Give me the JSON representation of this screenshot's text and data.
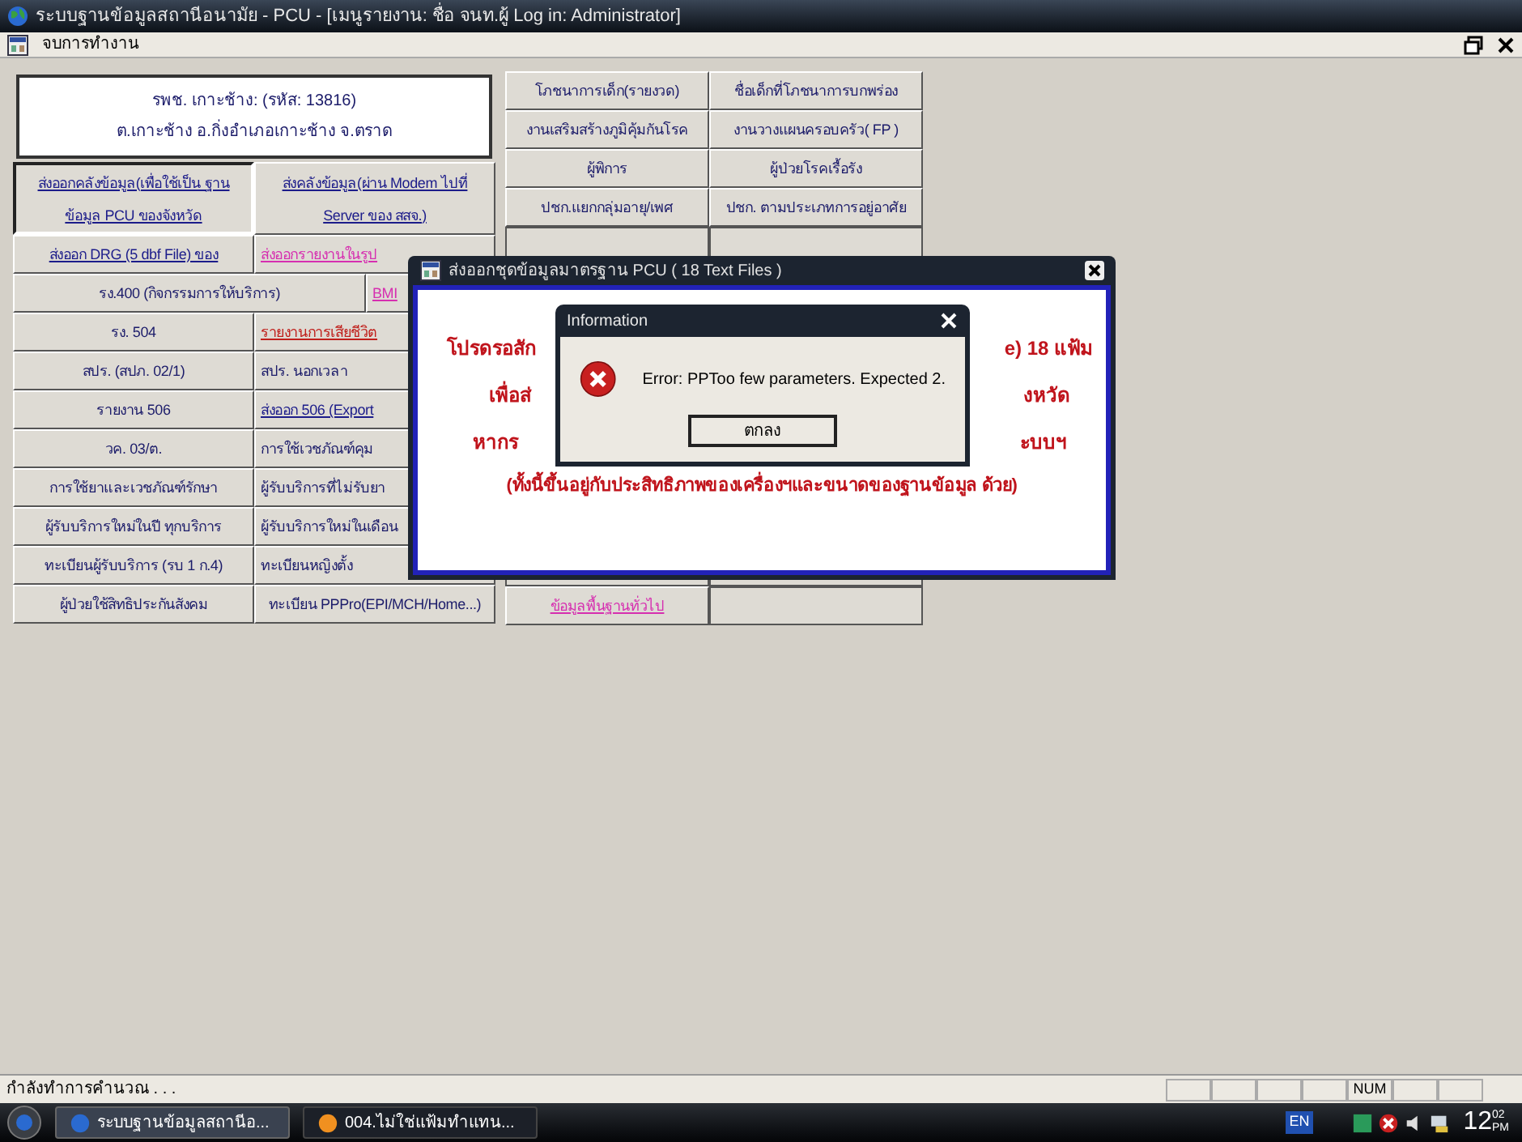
{
  "window": {
    "title": "ระบบฐานข้อมูลสถานีอนามัย - PCU - [เมนูรายงาน: ชื่อ จนท.ผู้ Log in: Administrator]"
  },
  "menu": {
    "items": [
      "จบการทำงาน"
    ]
  },
  "header": {
    "lines": [
      "รพช. เกาะช้าง: (รหัส: 13816)",
      "ต.เกาะช้าง อ.กิ่งอำเภอเกาะช้าง จ.ตราด"
    ]
  },
  "left_grid": {
    "rows": [
      {
        "cells": [
          {
            "text": "ส่งออกคลังข้อมูล(เพื่อใช้เป็น ฐานข้อมูล PCU ของจังหวัด",
            "kind": "link",
            "pressed": true
          },
          {
            "text": "ส่งคลังข้อมูล(ผ่าน Modem ไปที่ Server ของ สสจ.)",
            "kind": "link",
            "pressed": false
          }
        ]
      },
      {
        "cells": [
          {
            "text": "ส่งออก DRG (5 dbf File) ของ",
            "kind": "link",
            "pressed": false
          },
          {
            "text": "ส่งออกรายงานในรูป",
            "kind": "pink",
            "pressed": false,
            "cut": true
          }
        ]
      },
      {
        "cells": [
          {
            "text": "รง.400 (กิจกรรมการให้บริการ)",
            "kind": "plain",
            "pressed": false,
            "wide": true
          },
          {
            "text": "BMI",
            "kind": "pink",
            "pressed": false,
            "cut": true
          }
        ]
      },
      {
        "cells": [
          {
            "text": "รง. 504",
            "kind": "plain",
            "pressed": false
          },
          {
            "text": "รายงานการเสียชีวิต",
            "kind": "red",
            "pressed": false,
            "cut": true
          }
        ]
      },
      {
        "cells": [
          {
            "text": "สปร. (สปภ. 02/1)",
            "kind": "plain",
            "pressed": false
          },
          {
            "text": "สปร. นอกเวลา",
            "kind": "plain",
            "pressed": false,
            "cut": true
          }
        ]
      },
      {
        "cells": [
          {
            "text": "รายงาน 506",
            "kind": "plain",
            "pressed": false
          },
          {
            "text": "ส่งออก 506 (Export",
            "kind": "link",
            "pressed": false,
            "cut": true
          }
        ]
      },
      {
        "cells": [
          {
            "text": "วค. 03/ต.",
            "kind": "plain",
            "pressed": false
          },
          {
            "text": "การใช้เวชภัณฑ์คุม",
            "kind": "plain",
            "pressed": false,
            "cut": true
          }
        ]
      },
      {
        "cells": [
          {
            "text": "การใช้ยาและเวชภัณฑ์รักษา",
            "kind": "plain",
            "pressed": false
          },
          {
            "text": "ผู้รับบริการที่ไม่รับยา",
            "kind": "plain",
            "pressed": false,
            "cut": true
          }
        ]
      },
      {
        "cells": [
          {
            "text": "ผู้รับบริการใหม่ในปี ทุกบริการ",
            "kind": "plain",
            "pressed": false
          },
          {
            "text": "ผู้รับบริการใหม่ในเดือน",
            "kind": "plain",
            "pressed": false,
            "cut": true
          }
        ]
      },
      {
        "cells": [
          {
            "text": "ทะเบียนผู้รับบริการ (รบ 1 ก.4)",
            "kind": "plain",
            "pressed": false
          },
          {
            "text": "ทะเบียนหญิงตั้ง",
            "kind": "plain",
            "pressed": false,
            "cut": true
          }
        ]
      },
      {
        "cells": [
          {
            "text": "ผู้ป่วยใช้สิทธิประกันสังคม",
            "kind": "plain",
            "pressed": false
          },
          {
            "text": "ทะเบียน PPPro(EPI/MCH/Home...)",
            "kind": "plain",
            "pressed": false
          }
        ]
      }
    ]
  },
  "right_grid": {
    "rows": [
      {
        "cells": [
          {
            "text": "โภชนาการเด็ก(รายงวด)",
            "kind": "plain"
          },
          {
            "text": "ชื่อเด็กที่โภชนาการบกพร่อง",
            "kind": "plain"
          }
        ]
      },
      {
        "cells": [
          {
            "text": "งานเสริมสร้างภูมิคุ้มกันโรค",
            "kind": "plain"
          },
          {
            "text": "งานวางแผนครอบครัว( FP )",
            "kind": "plain"
          }
        ]
      },
      {
        "cells": [
          {
            "text": "ผู้พิการ",
            "kind": "plain"
          },
          {
            "text": "ผู้ป่วยโรคเรื้อรัง",
            "kind": "plain"
          }
        ]
      },
      {
        "cells": [
          {
            "text": "ปชก.แยกกลุ่มอายุ/เพศ",
            "kind": "plain"
          },
          {
            "text": "ปชก. ตามประเภทการอยู่อาศัย",
            "kind": "plain"
          }
        ]
      }
    ],
    "bottom_row": [
      {
        "text": "ข้อมูลพื้นฐานทั่วไป",
        "kind": "pink"
      }
    ]
  },
  "export_dialog": {
    "title": "ส่งออกชุดข้อมูลมาตรฐาน PCU ( 18 Text Files )",
    "lines": [
      {
        "left": "โปรดรอสัก",
        "right": "e) 18 แฟ้ม"
      },
      {
        "left": "เพื่อส่",
        "right": "งหวัด"
      },
      {
        "left": "หากร",
        "right": "ะบบฯ"
      }
    ],
    "note": "(ทั้งนี้ขึ้นอยู่กับประสิทธิภาพของเครื่องฯและขนาดของฐานข้อมูล ด้วย)"
  },
  "message_box": {
    "title": "Information",
    "message": "Error: PPToo few parameters. Expected 2.",
    "button": "ตกลง"
  },
  "status_bar": {
    "text": "กำลังทำการคำนวณ . . .",
    "num_indicator": "NUM"
  },
  "taskbar": {
    "tasks": [
      {
        "label": "ระบบฐานข้อมูลสถานีอ...",
        "selected": true
      },
      {
        "label": "004.ไม่ใช่แฟ้มทำแทน...",
        "selected": false
      }
    ],
    "language": "EN",
    "clock": "12",
    "clock_minutes": "02",
    "clock_ampm": "PM"
  }
}
